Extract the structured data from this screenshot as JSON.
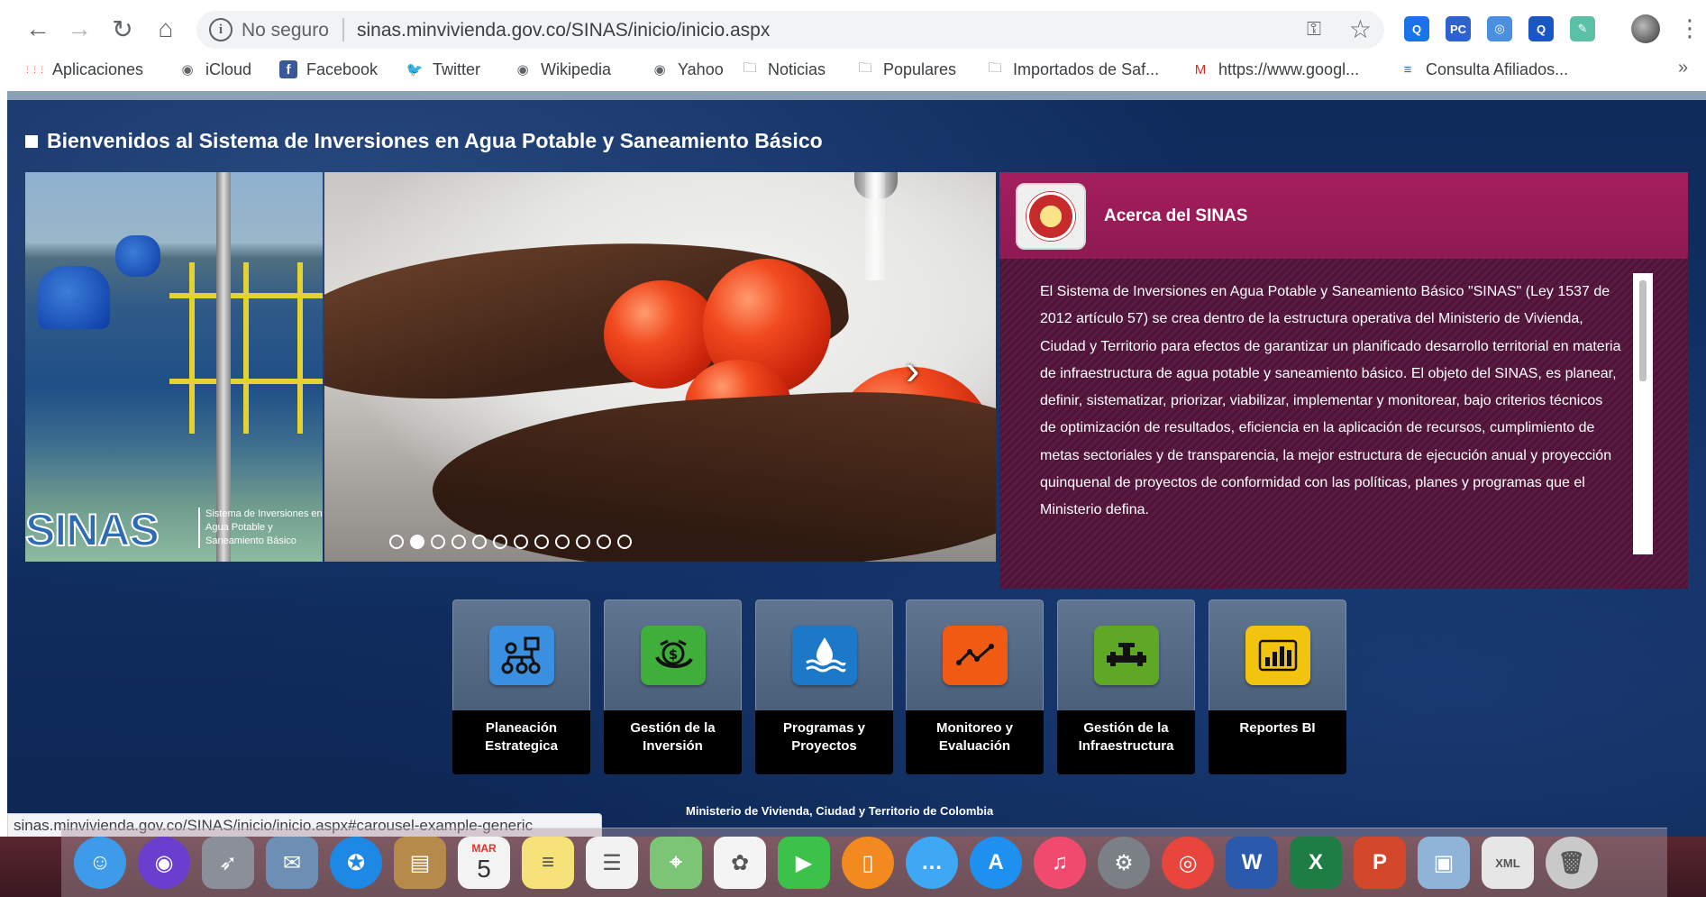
{
  "browser": {
    "security_label": "No seguro",
    "url": "sinas.minvivienda.gov.co/SINAS/inicio/inicio.aspx",
    "status_url": "sinas.minvivienda.gov.co/SINAS/inicio/inicio.aspx#carousel-example-generic",
    "bookmarks": [
      {
        "label": "Aplicaciones",
        "icon": "apps-grid-icon"
      },
      {
        "label": "iCloud",
        "icon": "globe-icon"
      },
      {
        "label": "Facebook",
        "icon": "facebook-icon"
      },
      {
        "label": "Twitter",
        "icon": "twitter-icon"
      },
      {
        "label": "Wikipedia",
        "icon": "globe-icon"
      },
      {
        "label": "Yahoo",
        "icon": "globe-icon"
      },
      {
        "label": "Noticias",
        "icon": "folder-icon"
      },
      {
        "label": "Populares",
        "icon": "folder-icon"
      },
      {
        "label": "Importados de Saf...",
        "icon": "folder-icon"
      },
      {
        "label": "https://www.googl...",
        "icon": "gmail-icon"
      },
      {
        "label": "Consulta Afiliados...",
        "icon": "site-icon"
      }
    ],
    "extensions": [
      {
        "text": "Q",
        "color": "#1a73e8"
      },
      {
        "text": "PC",
        "color": "#2d62d0"
      },
      {
        "text": "◎",
        "color": "#4a8fe0"
      },
      {
        "text": "Q",
        "color": "#1a56c4"
      },
      {
        "text": "✎",
        "color": "#5bc0a8"
      }
    ]
  },
  "page": {
    "welcome": "Bienvenidos al Sistema de Inversiones en Agua Potable y Saneamiento Básico",
    "logo_text": "SINAS",
    "logo_subtitle": "Sistema de Inversiones en Agua Potable y Saneamiento Básico",
    "carousel": {
      "slide_count": 12,
      "active_index": 1
    },
    "about": {
      "title": "Acerca del SINAS",
      "body": "El Sistema de Inversiones en Agua Potable y Saneamiento Básico \"SINAS\" (Ley 1537 de 2012 artículo 57) se crea dentro de la estructura operativa del Ministerio de Vivienda, Ciudad y Territorio para efectos de garantizar un planificado desarrollo territorial en materia de infraestructura de agua potable y saneamiento básico. El objeto del SINAS, es planear, definir, sistematizar, priorizar, viabilizar, implementar y monitorear, bajo criterios técnicos de optimización de resultados, eficiencia en la aplicación de recursos, cumplimiento de metas sectoriales y de transparencia, la mejor estructura de ejecución anual y proyección quinquenal de proyectos de conformidad con las políticas, planes y programas que el Ministerio defina."
    },
    "tiles": [
      {
        "line1": "Planeación",
        "line2": "Estrategica",
        "icon": "planning-flow-icon",
        "color": "#3b8fe0"
      },
      {
        "line1": "Gestión de la",
        "line2": "Inversión",
        "icon": "money-hand-icon",
        "color": "#3fae3a"
      },
      {
        "line1": "Programas y",
        "line2": "Proyectos",
        "icon": "water-drop-icon",
        "color": "#1c78c8"
      },
      {
        "line1": "Monitoreo y",
        "line2": "Evaluación",
        "icon": "trend-line-icon",
        "color": "#f05a12"
      },
      {
        "line1": "Gestión de la",
        "line2": "Infraestructura",
        "icon": "pipe-icon",
        "color": "#5fa826"
      },
      {
        "line1": "Reportes BI",
        "line2": "",
        "icon": "power-bi-icon",
        "color": "#f2c40f"
      }
    ],
    "footer": "Ministerio de Vivienda, Ciudad y Territorio de Colombia"
  },
  "dock": {
    "apps": [
      {
        "name": "finder-icon",
        "color": "#3d9be9"
      },
      {
        "name": "siri-icon",
        "color": "#6a3fd0"
      },
      {
        "name": "launchpad-icon",
        "color": "#8a8f99"
      },
      {
        "name": "mail-stamp-icon",
        "color": "#6c8fb3"
      },
      {
        "name": "safari-icon",
        "color": "#1e88e5"
      },
      {
        "name": "contacts-icon",
        "color": "#b58a4a"
      },
      {
        "name": "calendar-icon",
        "color": "#f3f3f3"
      },
      {
        "name": "notes-icon",
        "color": "#f7e27a"
      },
      {
        "name": "reminders-icon",
        "color": "#f2f2f2"
      },
      {
        "name": "maps-icon",
        "color": "#7cc576"
      },
      {
        "name": "photos-icon",
        "color": "#f4f4f4"
      },
      {
        "name": "facetime-icon",
        "color": "#3cc24a"
      },
      {
        "name": "books-icon",
        "color": "#f28a1f"
      },
      {
        "name": "messages-icon",
        "color": "#3fa8f5"
      },
      {
        "name": "app-store-icon",
        "color": "#1e90f0"
      },
      {
        "name": "music-icon",
        "color": "#f04a6e"
      },
      {
        "name": "system-preferences-icon",
        "color": "#7b7f86"
      },
      {
        "name": "chrome-icon",
        "color": "#e8453c"
      },
      {
        "name": "word-icon",
        "color": "#2b5aad"
      },
      {
        "name": "excel-icon",
        "color": "#1e7d45"
      },
      {
        "name": "powerpoint-icon",
        "color": "#d3472b"
      },
      {
        "name": "preview-icon",
        "color": "#8fb4d8"
      },
      {
        "name": "xml-document-icon",
        "color": "#e6e6e6"
      },
      {
        "name": "trash-icon",
        "color": "#c9c9c9"
      }
    ],
    "calendar_month": "MAR",
    "calendar_day": "5"
  }
}
